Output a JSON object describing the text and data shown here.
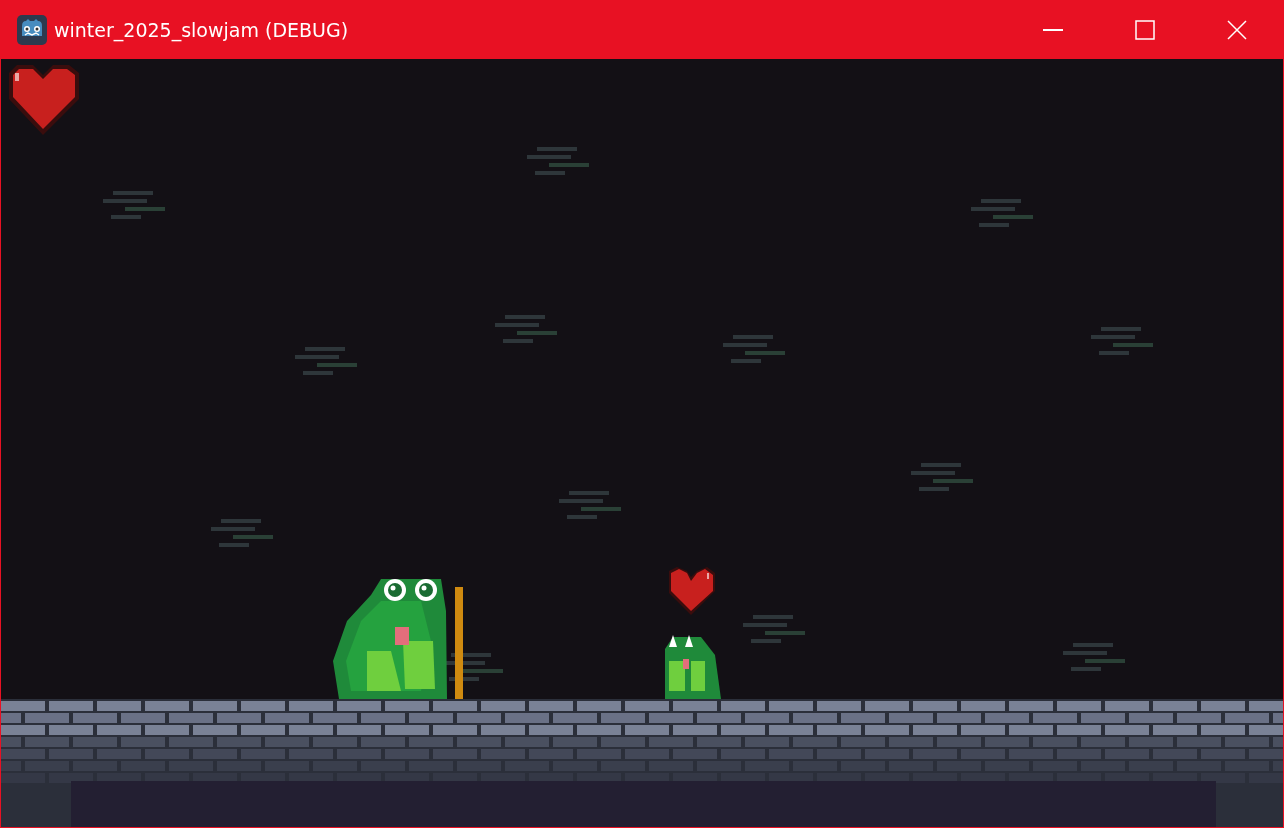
{
  "window": {
    "title": "winter_2025_slowjam (DEBUG)"
  }
}
